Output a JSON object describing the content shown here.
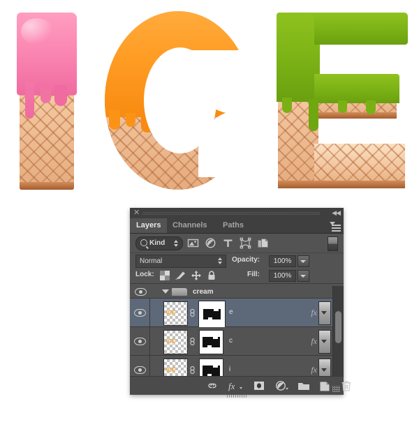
{
  "artwork": {
    "word": "ICE",
    "description": "waffle-cone ICE lettering with melting icing",
    "letters": [
      {
        "char": "I",
        "icing_color": "#f781b0",
        "cone_color": "#edb887"
      },
      {
        "char": "C",
        "icing_color": "#ff9d22",
        "cone_color": "#edb887"
      },
      {
        "char": "E",
        "icing_color": "#80b718",
        "cone_color": "#edb887"
      }
    ]
  },
  "panel": {
    "close_label": "✕",
    "collapse_label": "◀◀",
    "tabs": [
      {
        "label": "Layers",
        "active": true
      },
      {
        "label": "Channels",
        "active": false
      },
      {
        "label": "Paths",
        "active": false
      }
    ],
    "menu_icon": "panel-menu-icon",
    "filter": {
      "search_icon": "search-icon",
      "kind_label": "Kind",
      "stepper_icon": "updown-arrows-icon",
      "icons": [
        {
          "name": "filter-pixel-icon",
          "title": "pixel layers"
        },
        {
          "name": "filter-adjustment-icon",
          "title": "adjustment layers"
        },
        {
          "name": "filter-type-icon",
          "title": "type layers"
        },
        {
          "name": "filter-shape-icon",
          "title": "shape layers"
        },
        {
          "name": "filter-smartobject-icon",
          "title": "smart objects"
        }
      ],
      "toggle_name": "filter-enable-toggle"
    },
    "blend": {
      "mode_value": "Normal",
      "opacity_label": "Opacity:",
      "opacity_value": "100%",
      "fill_label": "Fill:",
      "fill_value": "100%"
    },
    "lock": {
      "label": "Lock:",
      "items": [
        {
          "name": "lock-transparency-icon"
        },
        {
          "name": "lock-image-icon"
        },
        {
          "name": "lock-position-icon"
        },
        {
          "name": "lock-all-icon"
        }
      ]
    },
    "group": {
      "name": "cream",
      "expanded": true,
      "visible": true
    },
    "layers": [
      {
        "name": "e",
        "visible": true,
        "selected": true,
        "has_fx": true,
        "fx_label": "fx",
        "linked": true,
        "mask_selected": true,
        "thumb_text": "ICE"
      },
      {
        "name": "c",
        "visible": true,
        "selected": false,
        "has_fx": true,
        "fx_label": "fx",
        "linked": true,
        "mask_selected": false,
        "thumb_text": "ICE"
      },
      {
        "name": "i",
        "visible": true,
        "selected": false,
        "has_fx": true,
        "fx_label": "fx",
        "linked": true,
        "mask_selected": false,
        "thumb_text": "ICE"
      }
    ],
    "bottom_toolbar": [
      {
        "name": "link-layers-icon"
      },
      {
        "name": "layer-style-fx-icon",
        "label": "fx"
      },
      {
        "name": "add-layer-mask-icon"
      },
      {
        "name": "new-adjustment-layer-icon"
      },
      {
        "name": "new-group-icon"
      },
      {
        "name": "new-layer-icon"
      },
      {
        "name": "delete-layer-icon"
      }
    ],
    "colors": {
      "panel_bg": "#535353",
      "list_bg": "#454545",
      "header_bg": "#3f3f3f",
      "selected_row": "#5d6878",
      "text": "#d4d4d4"
    }
  }
}
